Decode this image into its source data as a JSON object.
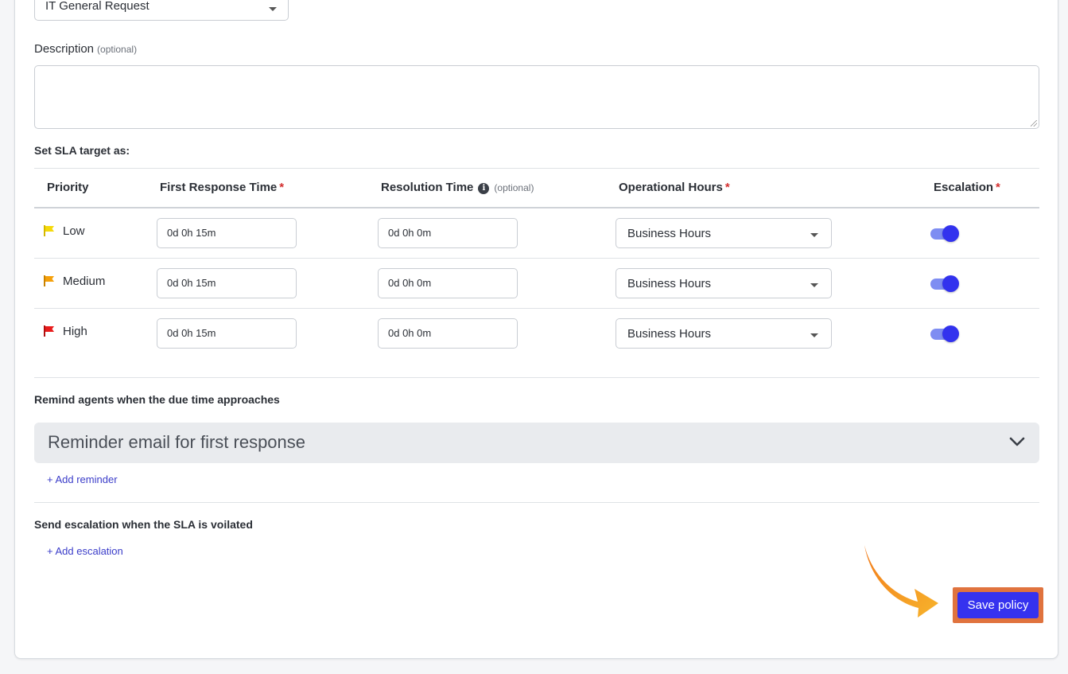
{
  "form": {
    "category_value": "IT General Request",
    "description_label": "Description",
    "description_optional": "(optional)",
    "description_value": "",
    "sla_title": "Set SLA target as:"
  },
  "table": {
    "headers": {
      "priority": "Priority",
      "first_response": "First Response Time",
      "resolution": "Resolution Time",
      "resolution_optional": "(optional)",
      "operational_hours": "Operational Hours",
      "escalation": "Escalation",
      "required_mark": "*",
      "info_glyph": "i"
    },
    "rows": [
      {
        "priority": "Low",
        "flag_color": "#f5d90a",
        "first_response": "0d 0h 15m",
        "resolution": "0d 0h 0m",
        "operational_hours": "Business Hours",
        "escalation_on": true
      },
      {
        "priority": "Medium",
        "flag_color": "#f5a00a",
        "first_response": "0d 0h 15m",
        "resolution": "0d 0h 0m",
        "operational_hours": "Business Hours",
        "escalation_on": true
      },
      {
        "priority": "High",
        "flag_color": "#e81c1c",
        "first_response": "0d 0h 15m",
        "resolution": "0d 0h 0m",
        "operational_hours": "Business Hours",
        "escalation_on": true
      }
    ]
  },
  "reminders": {
    "title": "Remind agents when the due time approaches",
    "accordion_title": "Reminder email for first response",
    "add_label": "+ Add reminder"
  },
  "escalation": {
    "title": "Send escalation when the SLA is voilated",
    "add_label": "+ Add escalation"
  },
  "actions": {
    "save_label": "Save policy"
  },
  "colors": {
    "primary": "#3532ef",
    "highlight": "#e0733e",
    "arrow": "#f5a623",
    "link": "#3a3cc9",
    "required": "#d32f2f"
  },
  "icons": {
    "flag": "flag-icon",
    "info": "info-icon",
    "caret": "caret-down-icon",
    "chevron": "chevron-down-icon",
    "arrow": "pointer-arrow-icon"
  }
}
